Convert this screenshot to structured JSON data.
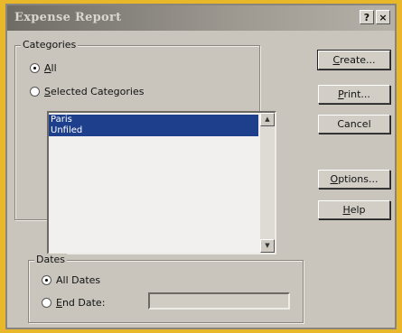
{
  "window": {
    "title": "Expense Report",
    "help_button": "?",
    "close_button": "×"
  },
  "categories": {
    "group_label": "Categories",
    "radio_all": "All",
    "radio_selected": "Selected Categories",
    "list_items": [
      "Paris",
      "Unfiled"
    ]
  },
  "dates": {
    "group_label": "Dates",
    "radio_all_dates": "All Dates",
    "radio_end_date": "End Date:",
    "end_date_value": ""
  },
  "buttons": {
    "create": "Create...",
    "print": "Print...",
    "cancel": "Cancel",
    "options": "Options...",
    "help": "Help"
  },
  "icons": {
    "scroll_up": "arrow-up-icon",
    "scroll_down": "arrow-down-icon"
  }
}
